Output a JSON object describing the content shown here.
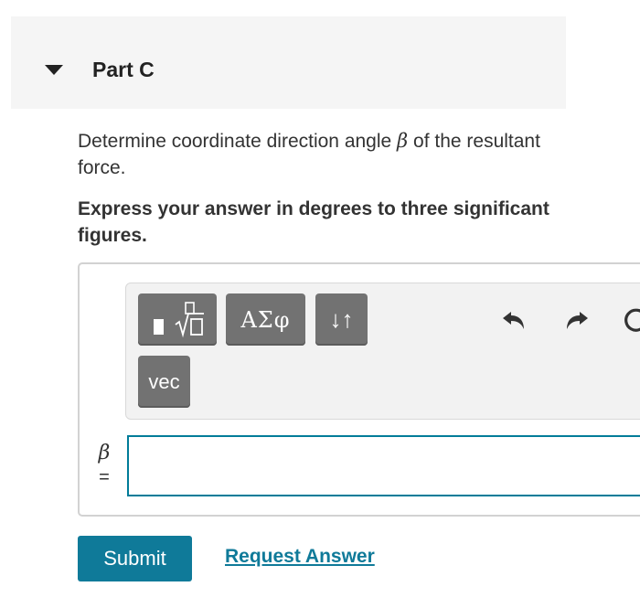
{
  "part": {
    "title": "Part C",
    "expanded": true
  },
  "question": {
    "text_before": "Determine coordinate direction angle ",
    "symbol": "β",
    "text_after": " of the resultant force."
  },
  "instruction": "Express your answer in degrees to three significant figures.",
  "toolbar": {
    "template_icon": "templates-icon",
    "greek_label": "ΑΣφ",
    "arrows_label": "↓↑",
    "vec_label": "vec",
    "undo_icon": "undo-icon",
    "redo_icon": "redo-icon",
    "reset_icon": "reset-icon"
  },
  "answer": {
    "symbol": "β",
    "equals": "=",
    "value": "",
    "placeholder": ""
  },
  "actions": {
    "submit_label": "Submit",
    "request_answer_label": "Request Answer"
  },
  "colors": {
    "accent": "#0f7a99",
    "input_border": "#007c99",
    "tool_button": "#727272",
    "header_bg": "#f5f5f5"
  }
}
